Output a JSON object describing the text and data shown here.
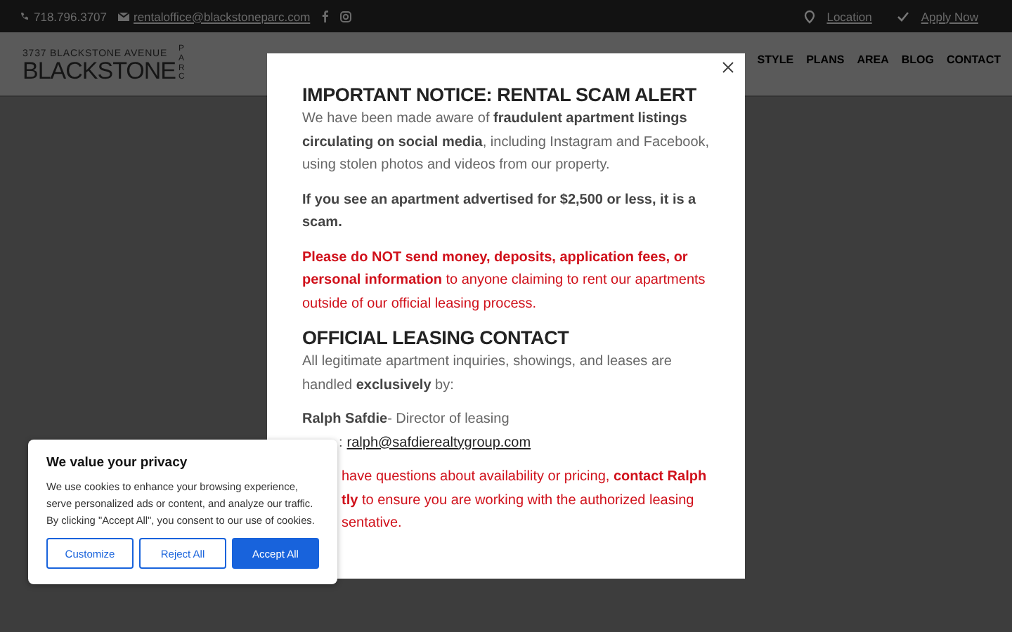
{
  "top_bar": {
    "phone": "718.796.3707",
    "email": "rentaloffice@blackstoneparc.com",
    "links": [
      "Location",
      "Apply Now"
    ]
  },
  "header": {
    "logo": {
      "address": "3737 BLACKSTONE AVENUE",
      "name": "BLACKSTONE",
      "suffix": "PARC"
    },
    "nav": [
      "STYLE",
      "PLANS",
      "AREA",
      "BLOG",
      "CONTACT"
    ]
  },
  "modal": {
    "title": "IMPORTANT NOTICE: RENTAL SCAM ALERT",
    "paragraphs": [
      {
        "kind": "plain",
        "text": "We have been made aware of **fraudulent apartment listings circulating on social media**, including Instagram and Facebook, using stolen photos and videos from our property."
      },
      {
        "kind": "bold",
        "text": "If you see an apartment advertised for $2,500 or less, it is a scam."
      },
      {
        "kind": "alert",
        "text": "**Please do NOT send money, deposits, application fees, or personal information** to anyone claiming to rent our apartments outside of our official leasing process."
      }
    ],
    "subtitle": "OFFICIAL LEASING CONTACT",
    "contact_intro": "All legitimate apartment inquiries, showings, and leases are handled **exclusively** by:",
    "contact_name": "**Ralph Safdie**- Director of leasing",
    "email_prefix": ":",
    "email": "ralph@safdierealtygroup.com",
    "closing_lines": [
      "have questions about availability or pricing, **contact Ralph**",
      "**tly** to ensure you are working with the authorized leasing",
      "sentative."
    ]
  },
  "cookie_banner": {
    "title": "We value your privacy",
    "text": "We use cookies to enhance your browsing experience, serve personalized ads or content, and analyze our traffic. By clicking \"Accept All\", you consent to our use of cookies.",
    "buttons": [
      {
        "label": "Customize",
        "kind": "outline"
      },
      {
        "label": "Reject All",
        "kind": "outline"
      },
      {
        "label": "Accept All",
        "kind": "primary"
      }
    ]
  }
}
